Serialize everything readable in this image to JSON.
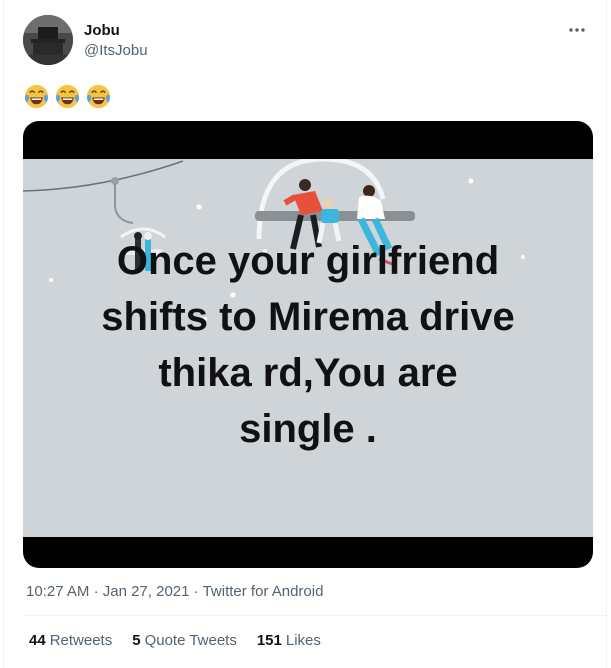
{
  "tweet": {
    "author_name": "Jobu",
    "author_handle": "@ItsJobu",
    "text_emoji": [
      "😂",
      "😂",
      "😂"
    ],
    "media": {
      "caption_lines": [
        "Once your girlfriend",
        "shifts to Mirema drive",
        "thika rd,You are",
        "single ."
      ]
    },
    "time": "10:27 AM",
    "date": "Jan 27, 2021",
    "source": "Twitter for Android",
    "separator": "·",
    "stats": {
      "retweets_count": "44",
      "retweets_label": "Retweets",
      "quote_count": "5",
      "quote_label": "Quote Tweets",
      "likes_count": "151",
      "likes_label": "Likes"
    }
  },
  "icons": {
    "more": "more-horizontal-icon",
    "emoji": "face-with-tears-of-joy-emoji"
  }
}
